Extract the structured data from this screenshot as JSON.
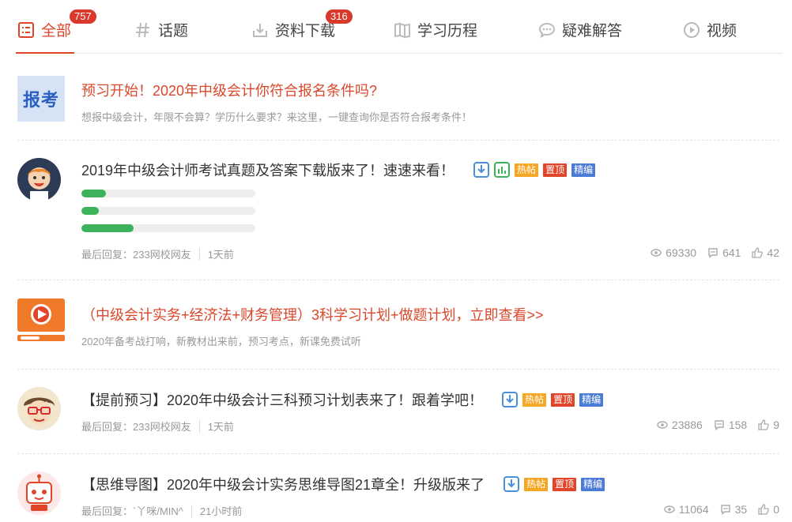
{
  "tabs": [
    {
      "label": "全部",
      "icon": "list-icon",
      "badge": "757",
      "active": true
    },
    {
      "label": "话题",
      "icon": "hash-icon"
    },
    {
      "label": "资料下载",
      "icon": "download-icon",
      "badge": "316"
    },
    {
      "label": "学习历程",
      "icon": "book-icon"
    },
    {
      "label": "疑难解答",
      "icon": "chat-icon"
    },
    {
      "label": "视频",
      "icon": "play-icon"
    }
  ],
  "posts": [
    {
      "kind": "promo",
      "thumb_text": "报考",
      "title": "预习开始！2020年中级会计你符合报名条件吗?",
      "subtitle": "想报中级会计，年限不会算？学历什么要求？来这里，一键查询你是否符合报考条件！"
    },
    {
      "kind": "thread",
      "title": "2019年中级会计师考试真题及答案下载版来了！速速来看！",
      "tags": [
        "热帖",
        "置顶",
        "精编"
      ],
      "poll_progress": [
        0.14,
        0.1,
        0.3
      ],
      "last_reply_label": "最后回复：233网校网友",
      "time": "1天前",
      "views": "69330",
      "replies": "641",
      "likes": "42"
    },
    {
      "kind": "promo",
      "title": "（中级会计实务+经济法+财务管理）3科学习计划+做题计划，立即查看>>",
      "subtitle": "2020年备考战打响，新教材出来前，预习考点，新课免费试听"
    },
    {
      "kind": "thread",
      "title": "【提前预习】2020年中级会计三科预习计划表来了！跟着学吧！",
      "tags": [
        "热帖",
        "置顶",
        "精编"
      ],
      "last_reply_label": "最后回复：233网校网友",
      "time": "1天前",
      "views": "23886",
      "replies": "158",
      "likes": "9"
    },
    {
      "kind": "thread",
      "title": "【思维导图】2020年中级会计实务思维导图21章全！升级版来了",
      "tags": [
        "热帖",
        "置顶",
        "精编"
      ],
      "last_reply_label": "最后回复：`丫咪/MIN^",
      "time": "21小时前",
      "views": "11064",
      "replies": "35",
      "likes": "0"
    }
  ],
  "colors": {
    "accent": "#e0452a",
    "hot": "#f5a623",
    "top": "#e0452a",
    "best": "#4a7bd6",
    "progress": "#3cb35a"
  }
}
